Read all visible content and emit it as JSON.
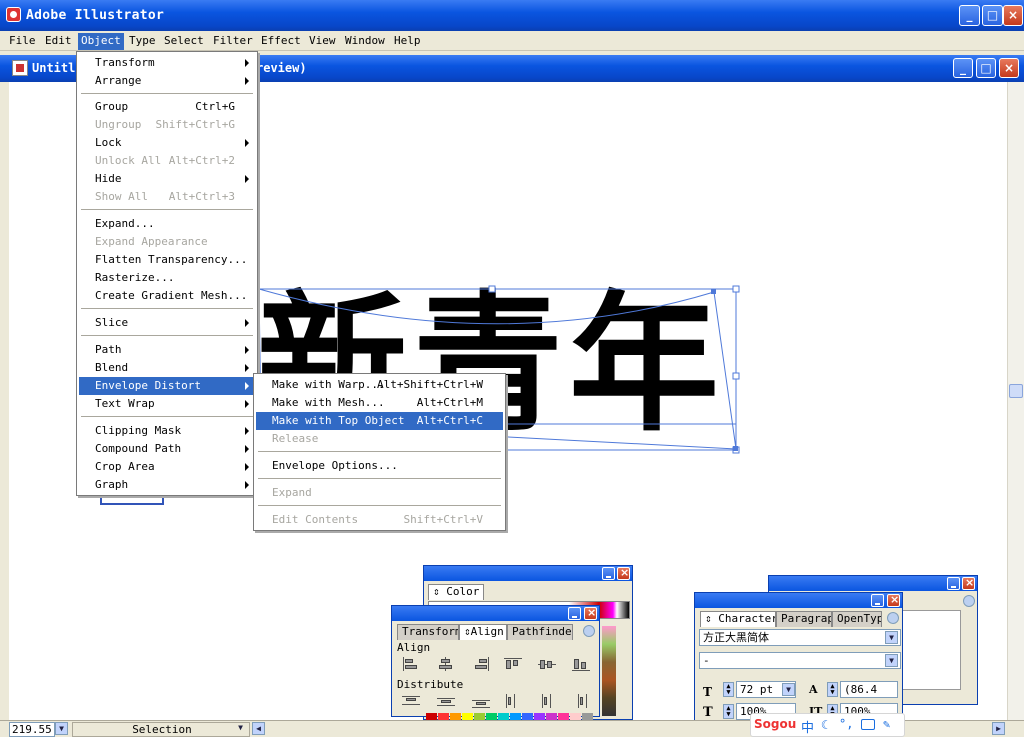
{
  "app": {
    "title": "Adobe Illustrator"
  },
  "menubar": {
    "items": [
      {
        "label": "File"
      },
      {
        "label": "Edit"
      },
      {
        "label": "Object"
      },
      {
        "label": "Type"
      },
      {
        "label": "Select"
      },
      {
        "label": "Filter"
      },
      {
        "label": "Effect"
      },
      {
        "label": "View"
      },
      {
        "label": "Window"
      },
      {
        "label": "Help"
      }
    ]
  },
  "document": {
    "title_left": "Untitl",
    "title_right": "review)"
  },
  "artwork": {
    "text": "新青年"
  },
  "object_menu": {
    "items": [
      {
        "label": "Transform",
        "shortcut": ""
      },
      {
        "label": "Arrange",
        "shortcut": ""
      },
      {
        "label": "Group",
        "shortcut": "Ctrl+G"
      },
      {
        "label": "Ungroup",
        "shortcut": "Shift+Ctrl+G"
      },
      {
        "label": "Lock",
        "shortcut": ""
      },
      {
        "label": "Unlock All",
        "shortcut": "Alt+Ctrl+2"
      },
      {
        "label": "Hide",
        "shortcut": ""
      },
      {
        "label": "Show All",
        "shortcut": "Alt+Ctrl+3"
      },
      {
        "label": "Expand...",
        "shortcut": ""
      },
      {
        "label": "Expand Appearance",
        "shortcut": ""
      },
      {
        "label": "Flatten Transparency...",
        "shortcut": ""
      },
      {
        "label": "Rasterize...",
        "shortcut": ""
      },
      {
        "label": "Create Gradient Mesh...",
        "shortcut": ""
      },
      {
        "label": "Slice",
        "shortcut": ""
      },
      {
        "label": "Path",
        "shortcut": ""
      },
      {
        "label": "Blend",
        "shortcut": ""
      },
      {
        "label": "Envelope Distort",
        "shortcut": ""
      },
      {
        "label": "Text Wrap",
        "shortcut": ""
      },
      {
        "label": "Clipping Mask",
        "shortcut": ""
      },
      {
        "label": "Compound Path",
        "shortcut": ""
      },
      {
        "label": "Crop Area",
        "shortcut": ""
      },
      {
        "label": "Graph",
        "shortcut": ""
      }
    ]
  },
  "envelope_menu": {
    "items": [
      {
        "label": "Make with Warp...",
        "shortcut": "Alt+Shift+Ctrl+W"
      },
      {
        "label": "Make with Mesh...",
        "shortcut": "Alt+Ctrl+M"
      },
      {
        "label": "Make with Top Object",
        "shortcut": "Alt+Ctrl+C"
      },
      {
        "label": "Release",
        "shortcut": ""
      },
      {
        "label": "Envelope Options...",
        "shortcut": ""
      },
      {
        "label": "Expand",
        "shortcut": ""
      },
      {
        "label": "Edit Contents",
        "shortcut": "Shift+Ctrl+V"
      }
    ]
  },
  "color_palette": {
    "tab": "Color"
  },
  "align_palette": {
    "tabs": [
      "Transform",
      "Align",
      "Pathfinder"
    ],
    "align_label": "Align",
    "distribute_label": "Distribute"
  },
  "character_palette": {
    "tabs": [
      "Character",
      "Paragraph",
      "OpenType"
    ],
    "font_family": "方正大黑简体",
    "font_style": "-",
    "font_size": "72 pt",
    "leading": "(86.4",
    "horizontal_scale": "100%",
    "vertical_scale": "100%"
  },
  "statusbar": {
    "zoom": "219.55",
    "tool": "Selection"
  },
  "ime": {
    "brand": "Sogou",
    "mode": "中"
  }
}
